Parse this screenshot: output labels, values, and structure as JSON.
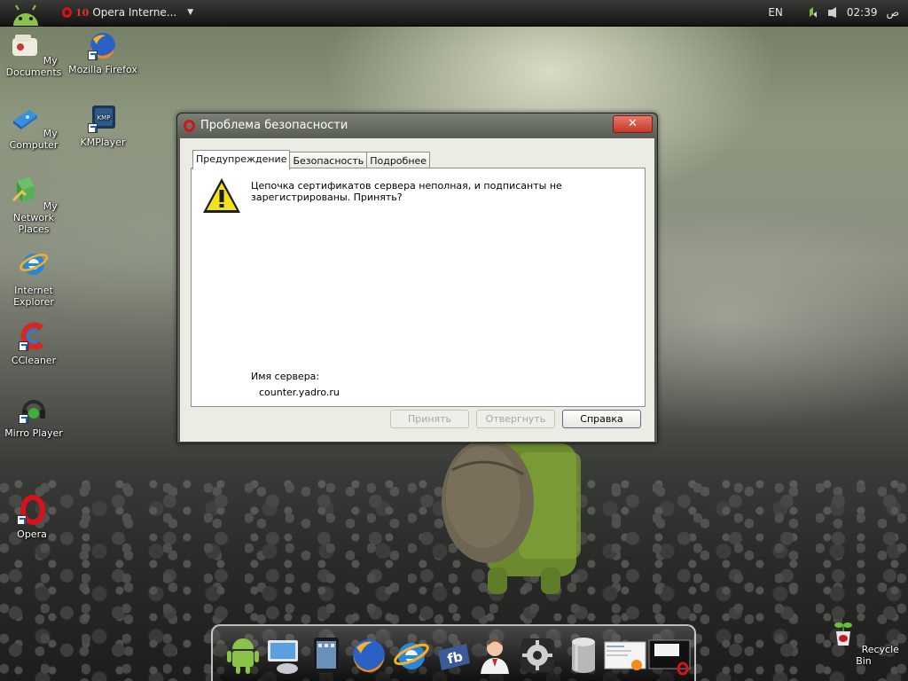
{
  "topbar": {
    "task_count": "10",
    "task_title": "Opera Interne...",
    "language": "EN",
    "ampm": "ص",
    "time": "02:39"
  },
  "desktop_icons": [
    {
      "name": "my-documents",
      "label": "My Documents"
    },
    {
      "name": "mozilla-firefox",
      "label": "Mozilla Firefox"
    },
    {
      "name": "my-computer",
      "label": "My Computer"
    },
    {
      "name": "kmplayer",
      "label": "KMPlayer"
    },
    {
      "name": "my-network-places",
      "label": "My Network Places"
    },
    {
      "name": "internet-explorer",
      "label": "Internet Explorer"
    },
    {
      "name": "ccleaner",
      "label": "CCleaner"
    },
    {
      "name": "mirro-player",
      "label": "Mirro Player"
    },
    {
      "name": "opera",
      "label": "Opera"
    },
    {
      "name": "recycle-bin",
      "label": "Recycle Bin"
    }
  ],
  "dialog": {
    "title": "Проблема безопасности",
    "close": "✕",
    "tabs": [
      "Предупреждение",
      "Безопасность",
      "Подробнее"
    ],
    "message": "Цепочка сертификатов сервера неполная, и подписанты не зарегистрированы. Принять?",
    "server_label": "Имя сервера:",
    "server_value": "counter.yadro.ru",
    "buttons": {
      "accept": "Принять",
      "reject": "Отвергнуть",
      "help": "Справка"
    }
  },
  "dock_items": [
    "android-icon",
    "computer-icon",
    "tablet-icon",
    "firefox-icon",
    "internet-explorer-icon",
    "facebook-icon",
    "contacts-icon",
    "settings-icon",
    "recycle-cylinder-icon",
    "window-preview-icon",
    "opera-window-icon"
  ],
  "colors": {
    "opera_red": "#d8121b",
    "close_button": "#c23a28",
    "dialog_frame": "#585c55"
  }
}
